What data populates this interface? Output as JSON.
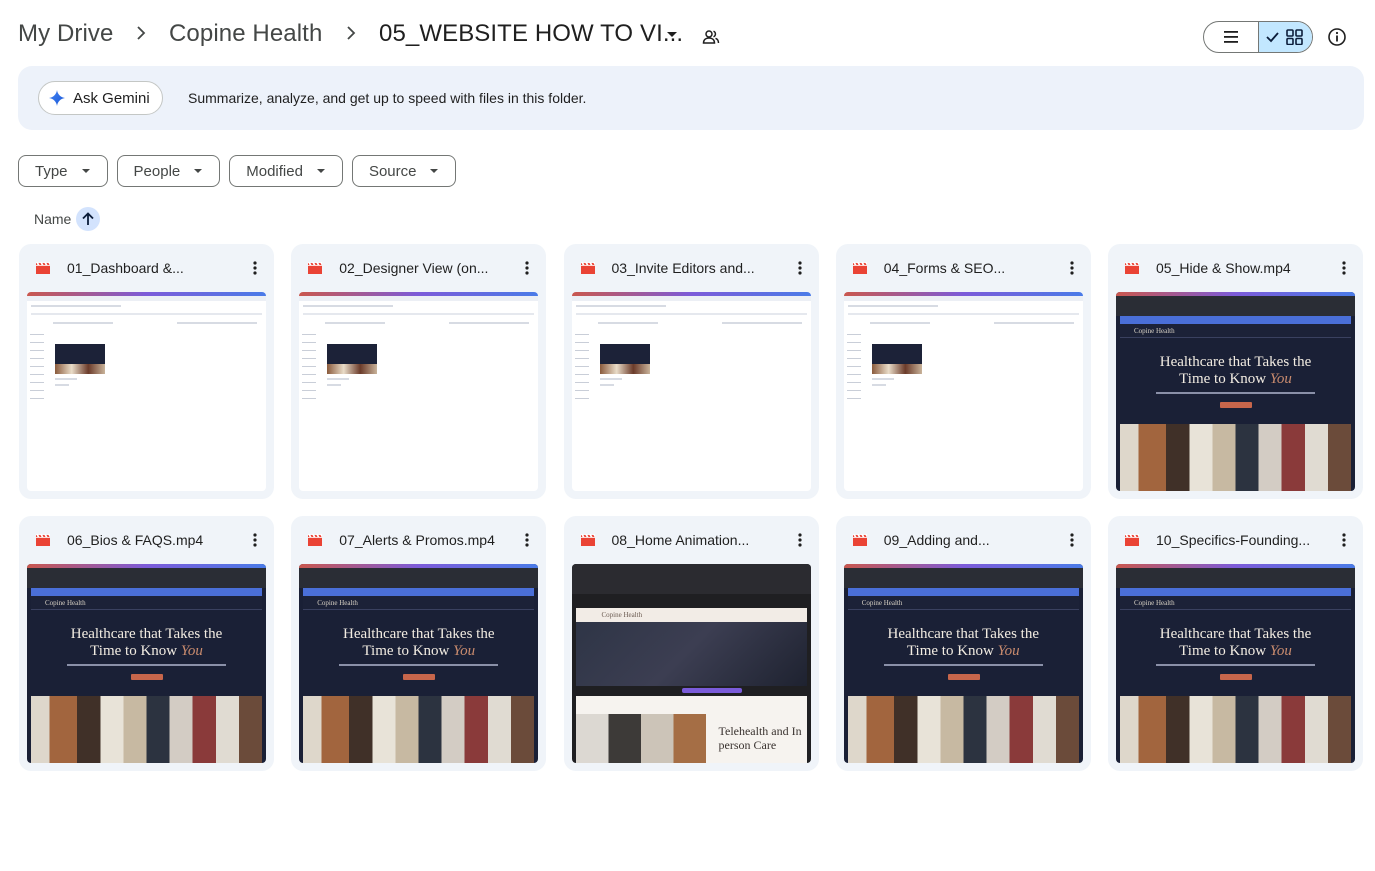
{
  "breadcrumb": {
    "root": "My Drive",
    "parent": "Copine Health",
    "current": "05_WEBSITE HOW TO VI..."
  },
  "gemini": {
    "button_label": "Ask Gemini",
    "prompt": "Summarize, analyze, and get up to speed with files in this folder."
  },
  "filters": [
    {
      "label": "Type"
    },
    {
      "label": "People"
    },
    {
      "label": "Modified"
    },
    {
      "label": "Source"
    }
  ],
  "sort": {
    "label": "Name",
    "direction": "ascending"
  },
  "view": {
    "mode": "grid"
  },
  "files": [
    {
      "name": "01_Dashboard &...",
      "thumb": "light"
    },
    {
      "name": "02_Designer View (on...",
      "thumb": "light"
    },
    {
      "name": "03_Invite Editors and...",
      "thumb": "light"
    },
    {
      "name": "04_Forms & SEO...",
      "thumb": "light"
    },
    {
      "name": "05_Hide & Show.mp4",
      "thumb": "dark"
    },
    {
      "name": "06_Bios & FAQS.mp4",
      "thumb": "dark"
    },
    {
      "name": "07_Alerts & Promos.mp4",
      "thumb": "dark"
    },
    {
      "name": "08_Home Animation...",
      "thumb": "tele"
    },
    {
      "name": "09_Adding and...",
      "thumb": "dark"
    },
    {
      "name": "10_Specifics-Founding...",
      "thumb": "dark"
    }
  ],
  "thumb_text": {
    "logo": "Copine Health",
    "headline_1": "Healthcare that Takes the",
    "headline_2": "Time to Know",
    "headline_you": "You",
    "tele_1": "Telehealth and In",
    "tele_2": "person Care"
  },
  "colors": {
    "accent": "#0b57d0",
    "toggle_active": "#c2e7ff",
    "gemini_bar": "#edf2fa",
    "card_bg": "#f0f4f9",
    "video_icon": "#ea4335"
  }
}
